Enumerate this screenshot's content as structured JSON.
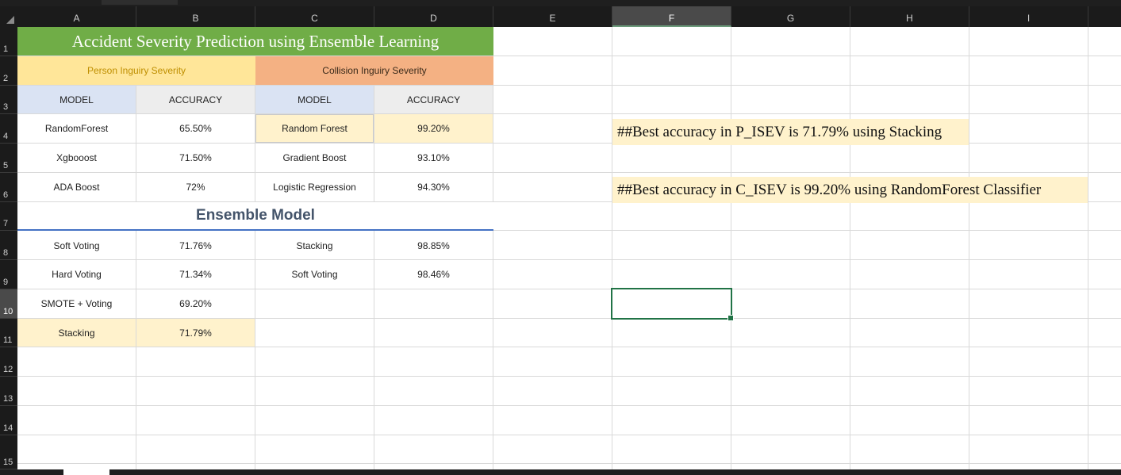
{
  "column_headers": [
    "A",
    "B",
    "C",
    "D",
    "E",
    "F",
    "G",
    "H",
    "I"
  ],
  "row_headers": [
    "1",
    "2",
    "3",
    "4",
    "5",
    "6",
    "7",
    "8",
    "9",
    "10",
    "11",
    "12",
    "13",
    "14",
    "15"
  ],
  "selected_column": "F",
  "selected_row": "10",
  "sheet": {
    "title": "Accident Severity Prediction using Ensemble Learning",
    "person_header": "Person Inguiry Severity",
    "collision_header": "Collision Inguiry Severity",
    "col_model": "MODEL",
    "col_accuracy": "ACCURACY",
    "person_rows": [
      {
        "model": "RandomForest",
        "accuracy": "65.50%"
      },
      {
        "model": "Xgbooost",
        "accuracy": "71.50%"
      },
      {
        "model": "ADA Boost",
        "accuracy": "72%"
      }
    ],
    "collision_rows": [
      {
        "model": "Random Forest",
        "accuracy": "99.20%"
      },
      {
        "model": "Gradient Boost",
        "accuracy": "93.10%"
      },
      {
        "model": "Logistic Regression",
        "accuracy": "94.30%"
      }
    ],
    "ensemble_title": "Ensemble Model",
    "person_ensemble": [
      {
        "model": "Soft Voting",
        "accuracy": "71.76%"
      },
      {
        "model": "Hard Voting",
        "accuracy": "71.34%"
      },
      {
        "model": "SMOTE + Voting",
        "accuracy": "69.20%"
      },
      {
        "model": "Stacking",
        "accuracy": "71.79%"
      }
    ],
    "collision_ensemble": [
      {
        "model": "Stacking",
        "accuracy": "98.85%"
      },
      {
        "model": "Soft Voting",
        "accuracy": "98.46%"
      }
    ],
    "note_p": "##Best accuracy in P_ISEV is 71.79% using Stacking",
    "note_c": "##Best accuracy in C_ISEV is 99.20% using RandomForest Classifier"
  },
  "colors": {
    "title_bg": "#70ad47",
    "person_header_bg": "#ffe699",
    "collision_header_bg": "#f4b183",
    "highlight_bg": "#fff2cc",
    "selection_border": "#217346"
  }
}
